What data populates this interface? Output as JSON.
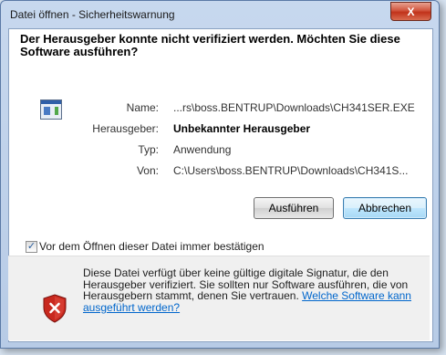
{
  "window": {
    "title": "Datei öffnen - Sicherheitswarnung",
    "close_label": "X"
  },
  "heading": "Der Herausgeber konnte nicht verifiziert werden. Möchten Sie diese Software ausführen?",
  "fields": {
    "name_label": "Name:",
    "name_value": "...rs\\boss.BENTRUP\\Downloads\\CH341SER.EXE",
    "publisher_label": "Herausgeber:",
    "publisher_value": "Unbekannter Herausgeber",
    "type_label": "Typ:",
    "type_value": "Anwendung",
    "from_label": "Von:",
    "from_value": "C:\\Users\\boss.BENTRUP\\Downloads\\CH341S..."
  },
  "buttons": {
    "run": "Ausführen",
    "cancel": "Abbrechen"
  },
  "checkbox": {
    "label": "Vor dem Öffnen dieser Datei immer bestätigen",
    "checked": true,
    "mark": "✓"
  },
  "warning": {
    "text": "Diese Datei verfügt über keine gültige digitale Signatur, die den Herausgeber verifiziert. Sie sollten nur Software ausführen, die von Herausgebern stammt, denen Sie vertrauen. ",
    "link": "Welche Software kann ausgeführt werden?"
  },
  "icons": {
    "file": "application-file-icon",
    "shield": "security-shield-error-icon"
  },
  "colors": {
    "link": "#0066cc",
    "close_button": "#c1321a",
    "shield_red": "#c8281e"
  }
}
